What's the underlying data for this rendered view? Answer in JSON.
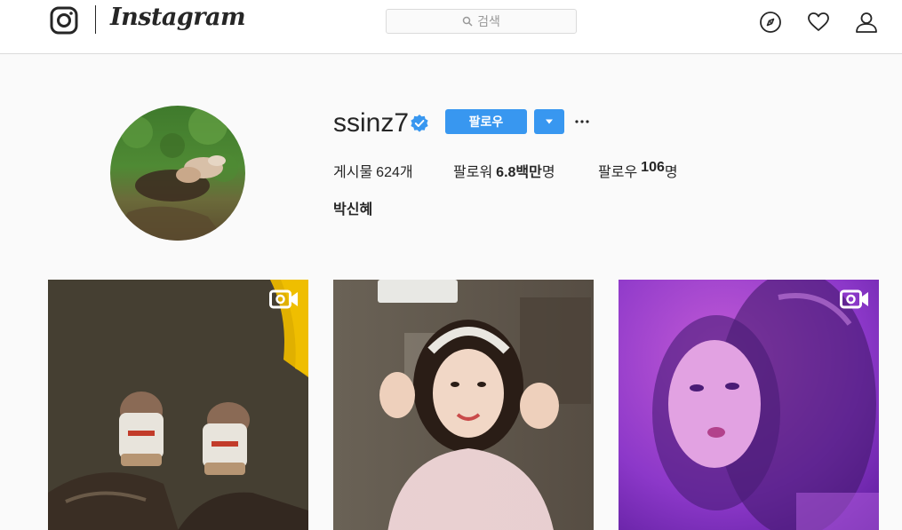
{
  "header": {
    "logo_name": "instagram-camera-icon",
    "wordmark": "Instagram",
    "search": {
      "placeholder": "검색",
      "icon": "search-icon"
    },
    "nav": [
      {
        "name": "explore",
        "icon": "compass-icon"
      },
      {
        "name": "activity",
        "icon": "heart-icon"
      },
      {
        "name": "profile",
        "icon": "user-icon"
      }
    ]
  },
  "profile": {
    "username": "ssinz7",
    "verified": true,
    "follow_label": "팔로우",
    "stats": {
      "posts_label": "게시물",
      "posts_value": "624개",
      "followers_label": "팔로워",
      "followers_value": "6.8백만",
      "followers_suffix": "명",
      "following_label": "팔로우",
      "following_value": "106",
      "following_suffix": "명"
    },
    "full_name": "박신혜"
  },
  "posts": [
    {
      "type": "video",
      "icon": "video-camera-icon",
      "description": "feet in slippers"
    },
    {
      "type": "photo",
      "description": "selfie with peace signs"
    },
    {
      "type": "video",
      "icon": "video-camera-icon",
      "description": "purple-lit selfie"
    }
  ],
  "colors": {
    "accent": "#3897f0",
    "border": "#dbdbdb",
    "background": "#fafafa",
    "text": "#262626"
  }
}
